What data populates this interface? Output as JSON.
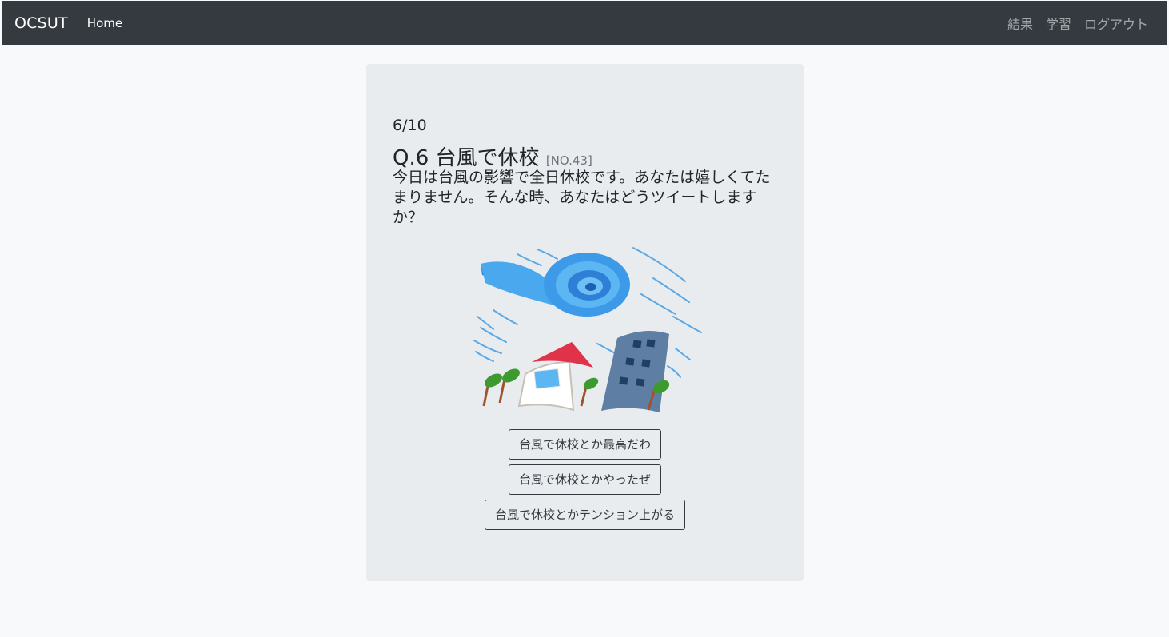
{
  "navbar": {
    "brand": "OCSUT",
    "home": "Home",
    "right": [
      {
        "label": "結果"
      },
      {
        "label": "学習"
      },
      {
        "label": "ログアウト"
      }
    ]
  },
  "quiz": {
    "progress": "6/10",
    "title": "Q.6 台風で休校",
    "number": "[NO.43]",
    "body": "今日は台風の影響で全日休校です。あなたは嬉しくてたまりません。そんな時、あなたはどうツイートしますか？",
    "illustration": "typhoon-illustration",
    "answers": [
      {
        "label": "台風で休校とか最高だわ"
      },
      {
        "label": "台風で休校とかやったぜ"
      },
      {
        "label": "台風で休校とかテンション上がる"
      }
    ]
  },
  "colors": {
    "navbar_bg": "#343a40",
    "page_bg": "#f8f9fa",
    "card_bg": "#e9ecef"
  }
}
